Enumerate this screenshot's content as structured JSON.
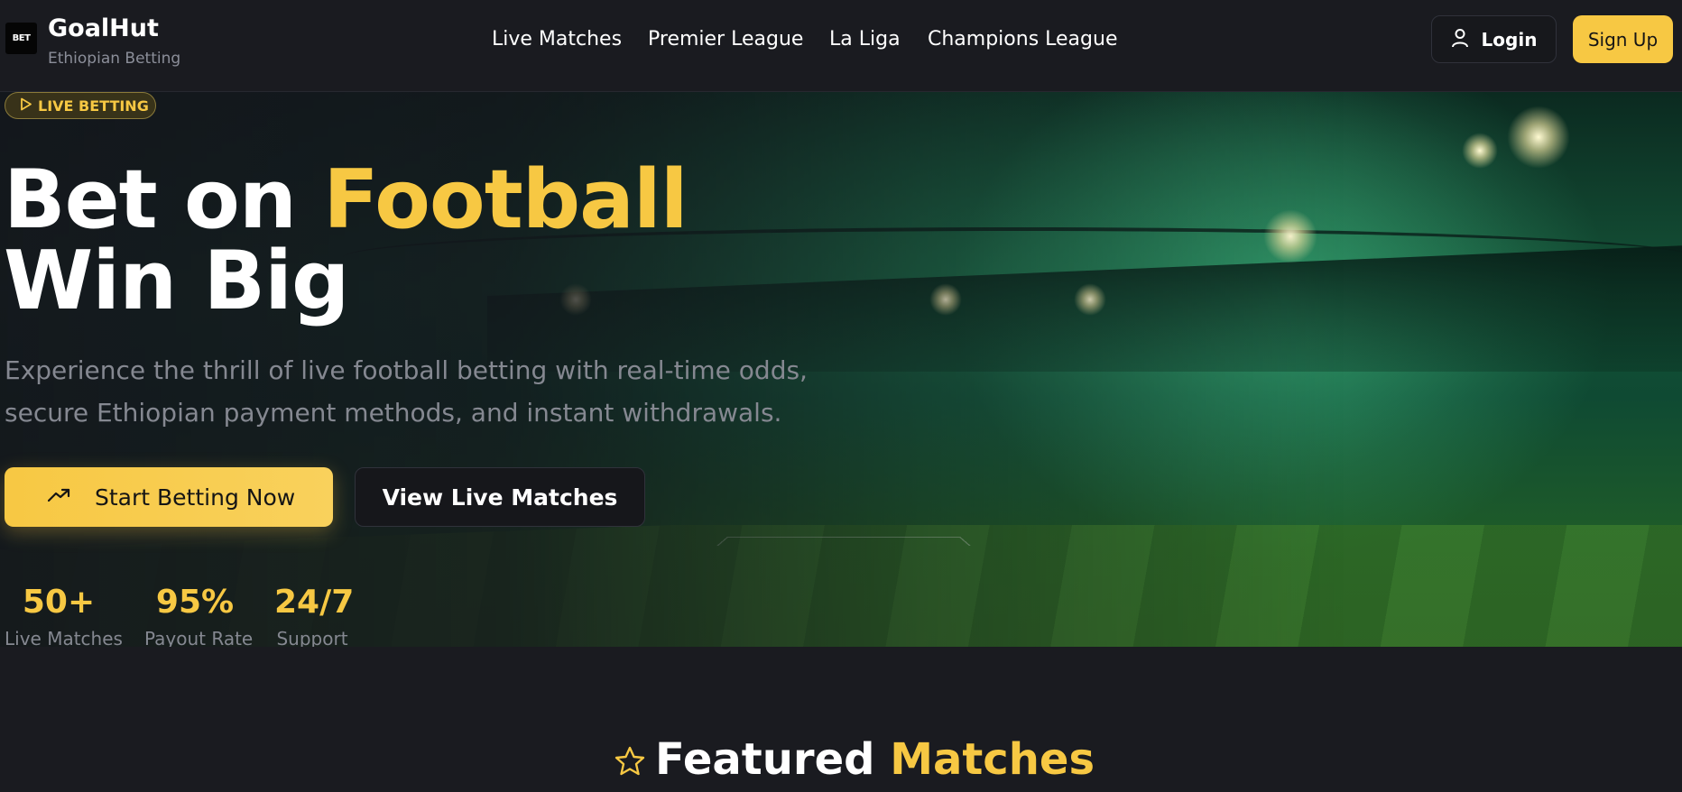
{
  "header": {
    "logo_text": "BET",
    "brand_name": "GoalHut",
    "brand_tagline": "Ethiopian Betting",
    "nav": [
      {
        "label": "Live Matches"
      },
      {
        "label": "Premier League"
      },
      {
        "label": "La Liga"
      },
      {
        "label": "Champions League"
      }
    ],
    "login_label": "Login",
    "login_icon": "user-icon",
    "signup_label": "Sign Up"
  },
  "hero": {
    "badge_label": "LIVE BETTING",
    "badge_icon": "play-icon",
    "headline_part1": "Bet on ",
    "headline_accent": "Football",
    "headline_line2": "Win Big",
    "description": "Experience the thrill of live football betting with real-time odds, secure Ethiopian payment methods, and instant withdrawals.",
    "primary_cta": "Start Betting Now",
    "primary_cta_icon": "trending-up-icon",
    "secondary_cta": "View Live Matches",
    "stats": [
      {
        "value": "50+",
        "caption": "Live Matches"
      },
      {
        "value": "95%",
        "caption": "Payout Rate"
      },
      {
        "value": "24/7",
        "caption": "Support"
      }
    ]
  },
  "featured": {
    "icon": "star-icon",
    "title_part1": "Featured ",
    "title_accent": "Matches"
  },
  "colors": {
    "accent": "#f7c843",
    "background": "#1a1b20",
    "muted_text": "#858891"
  }
}
